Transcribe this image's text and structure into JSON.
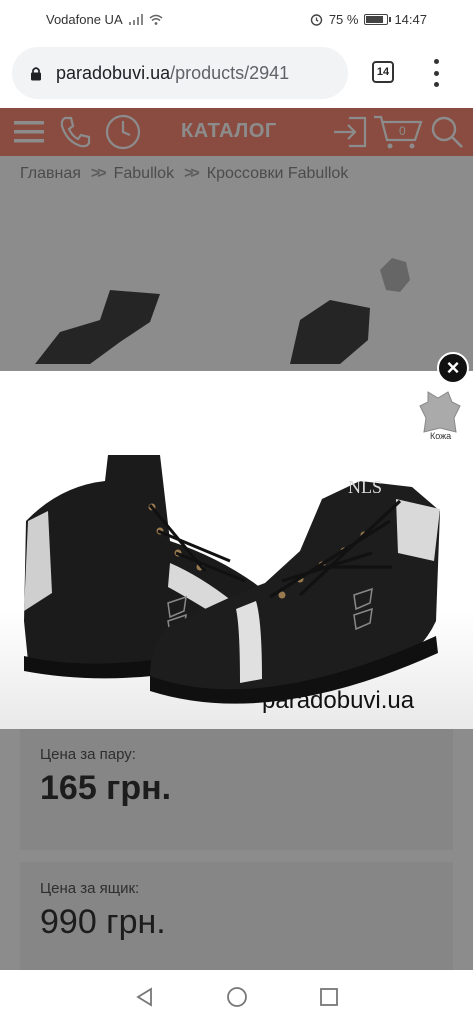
{
  "status_bar": {
    "carrier": "Vodafone UA",
    "battery": "75 %",
    "battery_level": 0.75,
    "time": "14:47"
  },
  "browser": {
    "url_domain": "paradobuvi.ua",
    "url_path": "/products/2941",
    "tab_count": "14"
  },
  "header": {
    "catalog_label": "КАТАЛОГ",
    "cart_count": "0"
  },
  "breadcrumb": {
    "items": [
      "Главная",
      "Fabullok",
      "Кроссовки Fabullok"
    ],
    "separator": ">>"
  },
  "lightbox": {
    "close_symbol": "×",
    "watermark": "paradobuvi.ua",
    "leather_label": "Кожа",
    "shoe_brand_print": "NLS"
  },
  "prices": {
    "pair_label": "Цена за пару:",
    "pair_value": "165 грн.",
    "box_label": "Цена за ящик:",
    "box_value": "990 грн."
  },
  "colors": {
    "header_bg": "#fc8b75",
    "header_fg": "#ffffff"
  }
}
